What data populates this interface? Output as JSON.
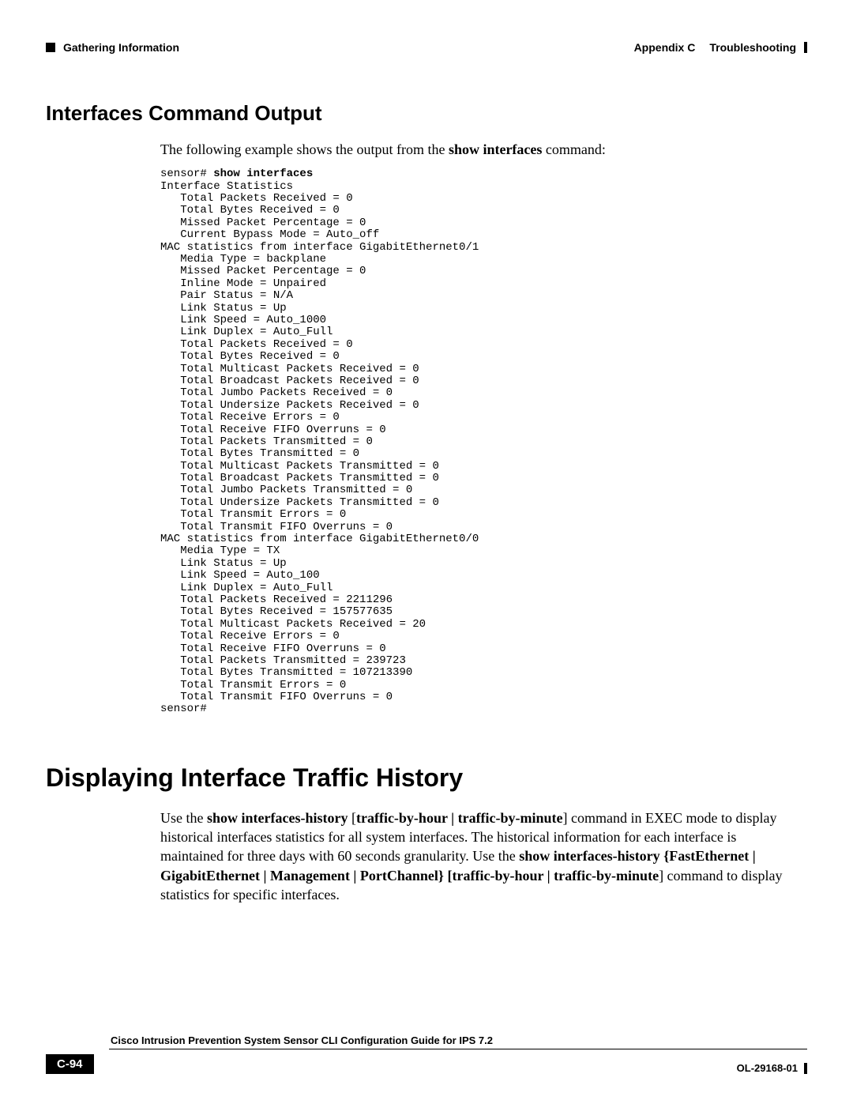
{
  "header": {
    "left": "Gathering Information",
    "right_label": "Appendix C",
    "right_title": "Troubleshooting"
  },
  "section1": {
    "title": "Interfaces Command Output",
    "intro_pre": "The following example shows the output from the ",
    "intro_cmd": "show interfaces",
    "intro_post": " command:",
    "code_prompt": "sensor# ",
    "code_cmd": "show interfaces",
    "code_lines": [
      "Interface Statistics",
      "   Total Packets Received = 0",
      "   Total Bytes Received = 0",
      "   Missed Packet Percentage = 0",
      "   Current Bypass Mode = Auto_off",
      "MAC statistics from interface GigabitEthernet0/1",
      "   Media Type = backplane",
      "   Missed Packet Percentage = 0",
      "   Inline Mode = Unpaired",
      "   Pair Status = N/A",
      "   Link Status = Up",
      "   Link Speed = Auto_1000",
      "   Link Duplex = Auto_Full",
      "   Total Packets Received = 0",
      "   Total Bytes Received = 0",
      "   Total Multicast Packets Received = 0",
      "   Total Broadcast Packets Received = 0",
      "   Total Jumbo Packets Received = 0",
      "   Total Undersize Packets Received = 0",
      "   Total Receive Errors = 0",
      "   Total Receive FIFO Overruns = 0",
      "   Total Packets Transmitted = 0",
      "   Total Bytes Transmitted = 0",
      "   Total Multicast Packets Transmitted = 0",
      "   Total Broadcast Packets Transmitted = 0",
      "   Total Jumbo Packets Transmitted = 0",
      "   Total Undersize Packets Transmitted = 0",
      "   Total Transmit Errors = 0",
      "   Total Transmit FIFO Overruns = 0",
      "MAC statistics from interface GigabitEthernet0/0",
      "   Media Type = TX",
      "   Link Status = Up",
      "   Link Speed = Auto_100",
      "   Link Duplex = Auto_Full",
      "   Total Packets Received = 2211296",
      "   Total Bytes Received = 157577635",
      "   Total Multicast Packets Received = 20",
      "   Total Receive Errors = 0",
      "   Total Receive FIFO Overruns = 0",
      "   Total Packets Transmitted = 239723",
      "   Total Bytes Transmitted = 107213390",
      "   Total Transmit Errors = 0",
      "   Total Transmit FIFO Overruns = 0",
      "sensor#"
    ]
  },
  "section2": {
    "title": "Displaying Interface Traffic History",
    "p1": "Use the ",
    "cmd1": "show interfaces-history",
    "p2": " [",
    "cmd2": "traffic-by-hour | traffic-by-minute",
    "p3": "] command in EXEC mode to display historical interfaces statistics for all system interfaces. The historical information for each interface is maintained for three days with 60 seconds granularity. Use the ",
    "cmd3": "show interfaces-history {FastEthernet | GigabitEthernet | Management | PortChannel} [traffic-by-hour | traffic-by-minute",
    "p4": "] command to display statistics for specific interfaces."
  },
  "footer": {
    "guide": "Cisco Intrusion Prevention System Sensor CLI Configuration Guide for IPS 7.2",
    "page": "C-94",
    "doc": "OL-29168-01"
  }
}
